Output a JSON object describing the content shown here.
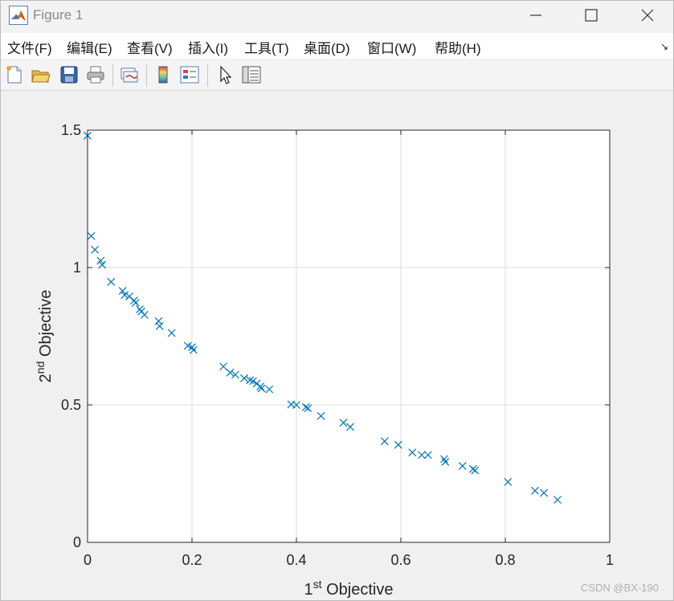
{
  "window": {
    "title": "Figure 1"
  },
  "menu": [
    {
      "label": "文件(F)"
    },
    {
      "label": "编辑(E)"
    },
    {
      "label": "查看(V)"
    },
    {
      "label": "插入(I)"
    },
    {
      "label": "工具(T)"
    },
    {
      "label": "桌面(D)"
    },
    {
      "label": "窗口(W)"
    },
    {
      "label": "帮助(H)"
    }
  ],
  "toolbar_icons": [
    "new-figure-icon",
    "open-file-icon",
    "save-icon",
    "print-icon",
    "link-plot-icon",
    "colorbar-icon",
    "legend-icon",
    "pointer-icon",
    "property-inspector-icon"
  ],
  "chart_data": {
    "type": "scatter",
    "marker": "x",
    "color": "#0072BD",
    "xlabel": {
      "base": "1",
      "sup": "st",
      "rest": " Objective"
    },
    "ylabel": {
      "base": "2",
      "sup": "nd",
      "rest": " Objective"
    },
    "xlim": [
      0,
      1
    ],
    "ylim": [
      0,
      1.5
    ],
    "xticks": [
      "0",
      "0.2",
      "0.4",
      "0.6",
      "0.8",
      "1"
    ],
    "yticks": [
      "0",
      "0.5",
      "1",
      "1.5"
    ],
    "grid": true,
    "points": [
      [
        0.0,
        1.48
      ],
      [
        0.007,
        1.115
      ],
      [
        0.014,
        1.065
      ],
      [
        0.025,
        1.025
      ],
      [
        0.028,
        1.01
      ],
      [
        0.045,
        0.948
      ],
      [
        0.067,
        0.915
      ],
      [
        0.071,
        0.9
      ],
      [
        0.08,
        0.895
      ],
      [
        0.089,
        0.88
      ],
      [
        0.092,
        0.872
      ],
      [
        0.1,
        0.848
      ],
      [
        0.103,
        0.84
      ],
      [
        0.109,
        0.828
      ],
      [
        0.136,
        0.805
      ],
      [
        0.138,
        0.787
      ],
      [
        0.161,
        0.762
      ],
      [
        0.192,
        0.715
      ],
      [
        0.2,
        0.71
      ],
      [
        0.203,
        0.7
      ],
      [
        0.26,
        0.64
      ],
      [
        0.273,
        0.618
      ],
      [
        0.283,
        0.61
      ],
      [
        0.3,
        0.597
      ],
      [
        0.311,
        0.59
      ],
      [
        0.317,
        0.587
      ],
      [
        0.324,
        0.578
      ],
      [
        0.331,
        0.567
      ],
      [
        0.333,
        0.56
      ],
      [
        0.348,
        0.557
      ],
      [
        0.39,
        0.502
      ],
      [
        0.4,
        0.5
      ],
      [
        0.418,
        0.492
      ],
      [
        0.422,
        0.488
      ],
      [
        0.447,
        0.46
      ],
      [
        0.49,
        0.435
      ],
      [
        0.503,
        0.42
      ],
      [
        0.569,
        0.368
      ],
      [
        0.595,
        0.355
      ],
      [
        0.622,
        0.327
      ],
      [
        0.64,
        0.318
      ],
      [
        0.652,
        0.318
      ],
      [
        0.683,
        0.303
      ],
      [
        0.685,
        0.293
      ],
      [
        0.718,
        0.278
      ],
      [
        0.738,
        0.267
      ],
      [
        0.742,
        0.262
      ],
      [
        0.805,
        0.22
      ],
      [
        0.857,
        0.188
      ],
      [
        0.874,
        0.18
      ],
      [
        0.9,
        0.155
      ]
    ]
  },
  "watermark": "CSDN @BX-190"
}
